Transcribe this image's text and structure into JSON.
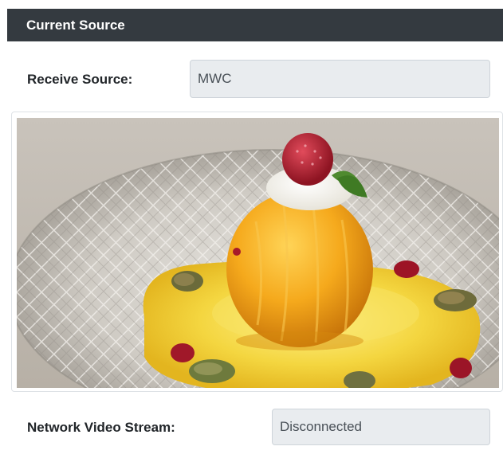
{
  "header": {
    "title": "Current Source"
  },
  "receive_source": {
    "label": "Receive Source:",
    "value": "MWC"
  },
  "network_stream": {
    "label": "Network Video Stream:",
    "value": "Disconnected"
  },
  "colors": {
    "header_bg": "#343a40",
    "field_bg": "#e9ecef",
    "field_border": "#ced4da"
  }
}
